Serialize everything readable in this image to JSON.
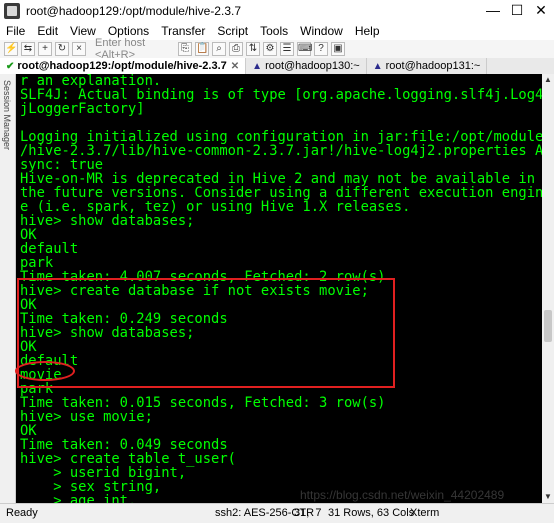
{
  "window": {
    "title": "root@hadoop129:/opt/module/hive-2.3.7",
    "controls": [
      "—",
      "☐",
      "✕"
    ]
  },
  "menu": [
    "File",
    "Edit",
    "View",
    "Options",
    "Transfer",
    "Script",
    "Tools",
    "Window",
    "Help"
  ],
  "toolbar": {
    "host_placeholder": "Enter host <Alt+R>"
  },
  "tabs": [
    {
      "label": "root@hadoop129:/opt/module/hive-2.3.7",
      "active": true,
      "status": "connected"
    },
    {
      "label": "root@hadoop130:~",
      "active": false,
      "status": "warning"
    },
    {
      "label": "root@hadoop131:~",
      "active": false,
      "status": "warning"
    }
  ],
  "sidebar": {
    "labels": [
      "Session Manager"
    ]
  },
  "terminal": {
    "lines": [
      "r an explanation.",
      "SLF4J: Actual binding is of type [org.apache.logging.slf4j.Log4",
      "jLoggerFactory]",
      "",
      "Logging initialized using configuration in jar:file:/opt/module",
      "/hive-2.3.7/lib/hive-common-2.3.7.jar!/hive-log4j2.properties A",
      "sync: true",
      "Hive-on-MR is deprecated in Hive 2 and may not be available in",
      "the future versions. Consider using a different execution engin",
      "e (i.e. spark, tez) or using Hive 1.X releases.",
      "hive> show databases;",
      "OK",
      "default",
      "park",
      "Time taken: 4.007 seconds, Fetched: 2 row(s)",
      "hive> create database if not exists movie;",
      "OK",
      "Time taken: 0.249 seconds",
      "hive> show databases;",
      "OK",
      "default",
      "movie",
      "park",
      "Time taken: 0.015 seconds, Fetched: 3 row(s)",
      "hive> use movie;",
      "OK",
      "Time taken: 0.049 seconds",
      "hive> create table t_user(",
      "    > userid bigint,",
      "    > sex string,",
      "    > age int,"
    ],
    "colors": {
      "text": "#00ff00",
      "background": "#000000",
      "annotation": "#e02020"
    }
  },
  "status": {
    "ready": "Ready",
    "ssh": "ssh2: AES-256-CTR",
    "cursor": "31,  7",
    "rows_cols": "31 Rows, 63 Cols",
    "term": "Xterm"
  },
  "watermark": "https://blog.csdn.net/weixin_44202489"
}
